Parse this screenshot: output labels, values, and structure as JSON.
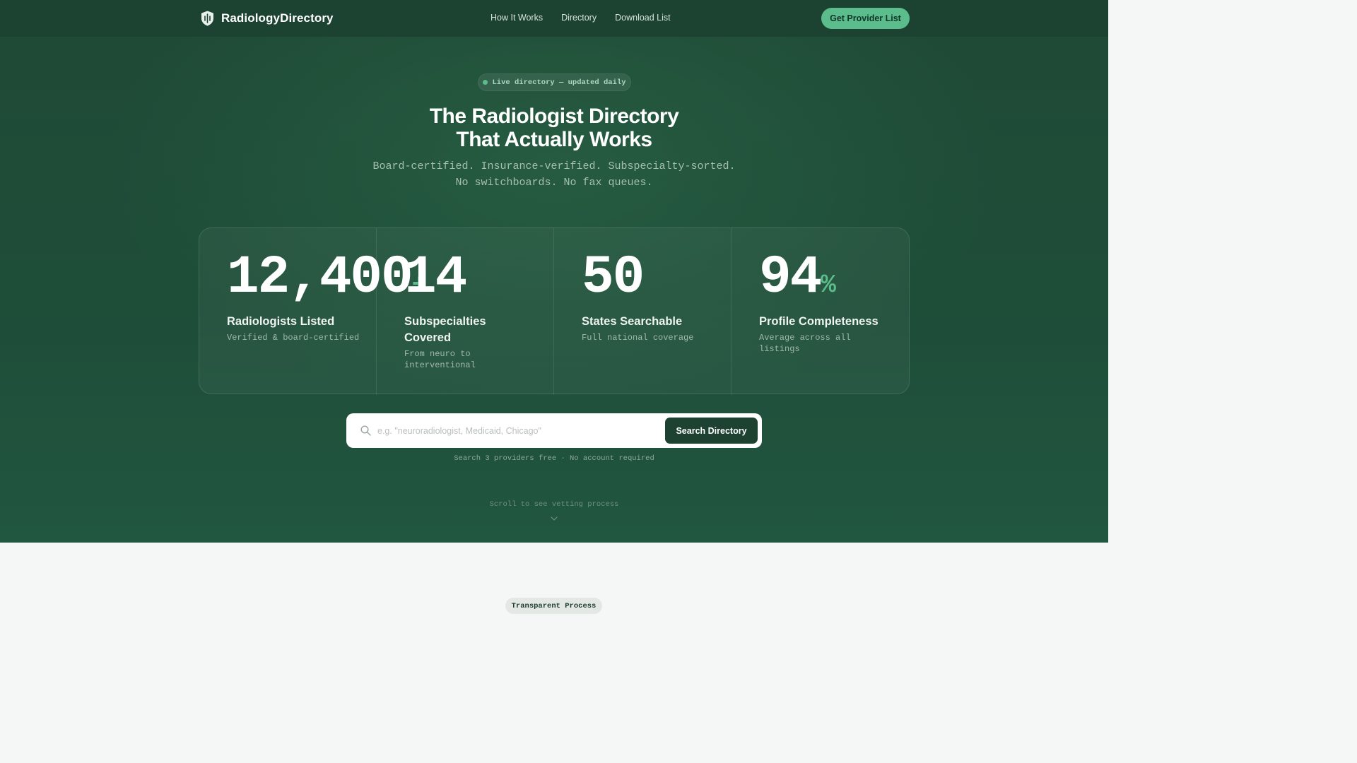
{
  "nav": {
    "brand": "RadiologyDirectory",
    "logo_icon": "shield-icon",
    "links": [
      "How It Works",
      "Directory",
      "Download List"
    ],
    "cta": "Get Provider List"
  },
  "hero": {
    "badge": "Live directory — updated daily",
    "headline_line1": "The Radiologist Directory",
    "headline_line2": "That Actually Works",
    "sub_line1": "Board-certified. Insurance-verified. Subspecialty-sorted.",
    "sub_line2": "No switchboards. No fax queues."
  },
  "stats": [
    {
      "value": "12,400",
      "suffix": "+",
      "label": "Radiologists Listed",
      "desc": "Verified & board-certified"
    },
    {
      "value": "14",
      "suffix": "",
      "label": "Subspecialties Covered",
      "desc": "From neuro to interventional"
    },
    {
      "value": "50",
      "suffix": "",
      "label": "States Searchable",
      "desc": "Full national coverage"
    },
    {
      "value": "94",
      "suffix": "%",
      "label": "Profile Completeness",
      "desc": "Average across all listings"
    }
  ],
  "search": {
    "placeholder": "e.g. \"neuroradiologist, Medicaid, Chicago\"",
    "value": "",
    "button": "Search Directory",
    "icon": "search-icon",
    "note": "Search 3 providers free · No account required"
  },
  "scroll_hint": "Scroll to see vetting process",
  "next_section": {
    "pill": "Transparent Process"
  },
  "colors": {
    "accent": "#5bbd8c",
    "hero_bg": "#1e4d38",
    "nav_bg": "#1c4232"
  }
}
